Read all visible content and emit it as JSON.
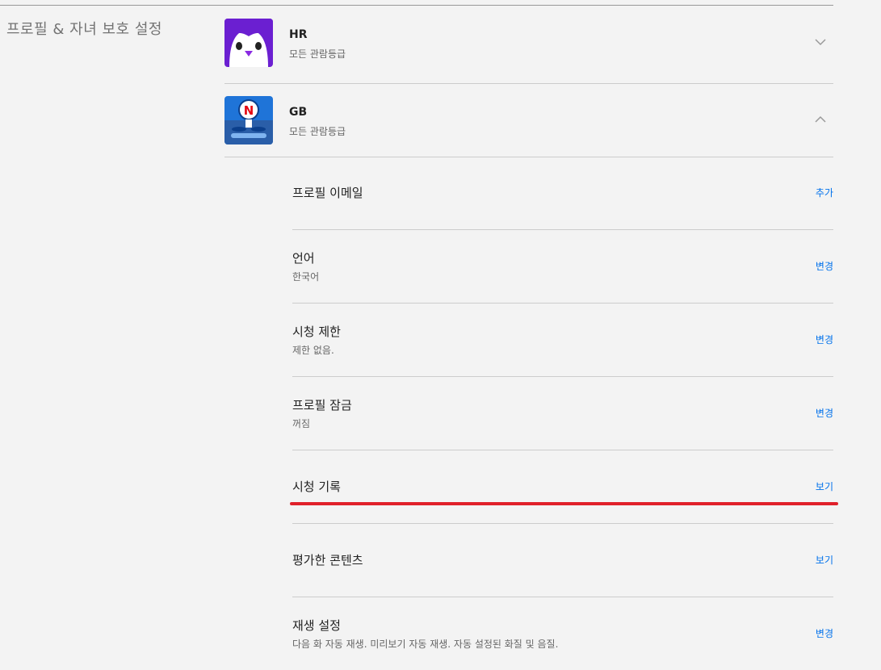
{
  "section": {
    "title": "프로필 & 자녀 보호 설정"
  },
  "profiles": [
    {
      "name": "HR",
      "rating": "모든 관람등급",
      "expanded": false,
      "avatar_icon": "penguin-icon",
      "avatar_color": "#6b1fd1"
    },
    {
      "name": "GB",
      "rating": "모든 관람등급",
      "expanded": true,
      "avatar_icon": "netflix-kid-icon",
      "avatar_color": "#1f74d8"
    }
  ],
  "settings": [
    {
      "title": "프로필 이메일",
      "subtitle": "",
      "action": "추가"
    },
    {
      "title": "언어",
      "subtitle": "한국어",
      "action": "변경"
    },
    {
      "title": "시청 제한",
      "subtitle": "제한 없음.",
      "action": "변경"
    },
    {
      "title": "프로필 잠금",
      "subtitle": "꺼짐",
      "action": "변경"
    },
    {
      "title": "시청 기록",
      "subtitle": "",
      "action": "보기"
    },
    {
      "title": "평가한 콘텐츠",
      "subtitle": "",
      "action": "보기"
    },
    {
      "title": "재생 설정",
      "subtitle": "다음 화 자동 재생. 미리보기 자동 재생. 자동 설정된 화질 및 음질.",
      "action": "변경"
    }
  ],
  "colors": {
    "accent_link": "#0071eb",
    "highlight_underline": "#e0202a",
    "background": "#f3f3f3"
  }
}
